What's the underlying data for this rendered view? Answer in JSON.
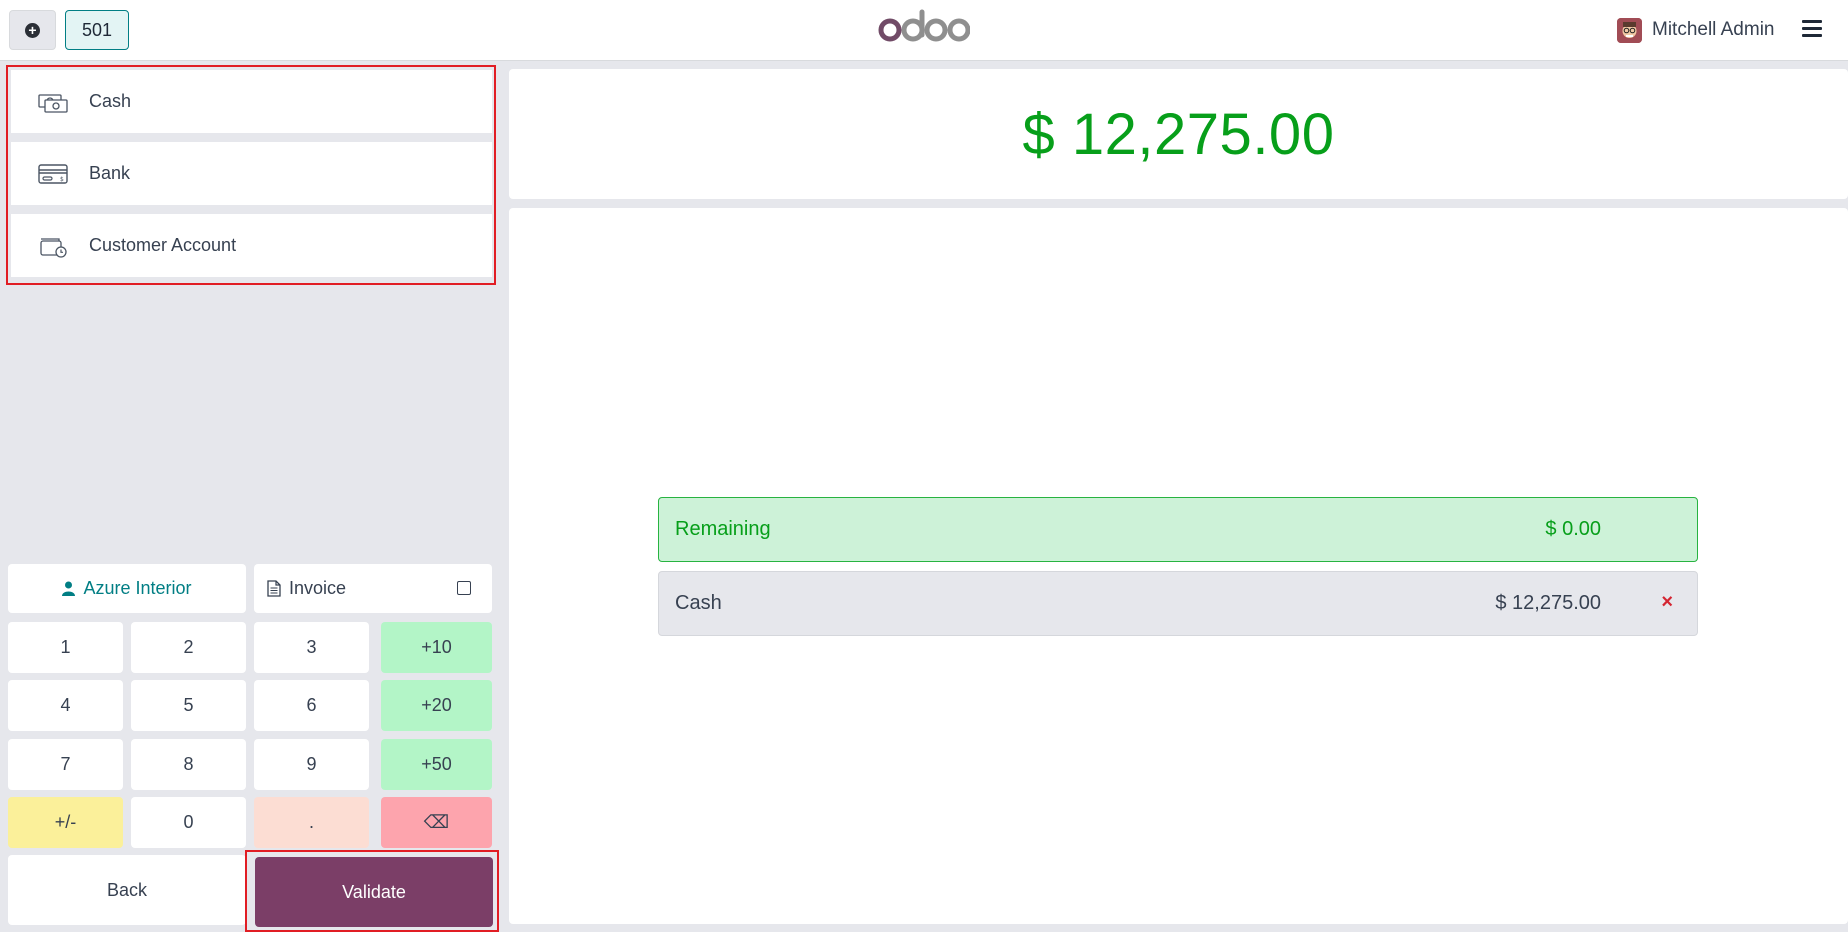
{
  "header": {
    "order_number": "501",
    "brand": "odoo",
    "user_name": "Mitchell Admin"
  },
  "payment_methods": [
    {
      "label": "Cash",
      "icon": "cash-icon"
    },
    {
      "label": "Bank",
      "icon": "bank-card-icon"
    },
    {
      "label": "Customer Account",
      "icon": "wallet-icon"
    }
  ],
  "partner": {
    "label": "Azure Interior",
    "icon": "user-icon"
  },
  "invoice": {
    "label": "Invoice",
    "checked": false
  },
  "numpad": {
    "k1": "1",
    "k2": "2",
    "k3": "3",
    "p10": "+10",
    "k4": "4",
    "k5": "5",
    "k6": "6",
    "p20": "+20",
    "k7": "7",
    "k8": "8",
    "k9": "9",
    "p50": "+50",
    "sign": "+/-",
    "k0": "0",
    "dot": ".",
    "backspace": "⌫"
  },
  "actions": {
    "back": "Back",
    "validate": "Validate"
  },
  "total": "$ 12,275.00",
  "remaining": {
    "label": "Remaining",
    "amount": "$ 0.00"
  },
  "payment_lines": [
    {
      "method": "Cash",
      "amount": "$ 12,275.00",
      "delete": "×"
    }
  ],
  "colors": {
    "accent": "#017e84",
    "brand": "#7b3e67",
    "success": "#079f1a",
    "danger": "#d42532"
  }
}
